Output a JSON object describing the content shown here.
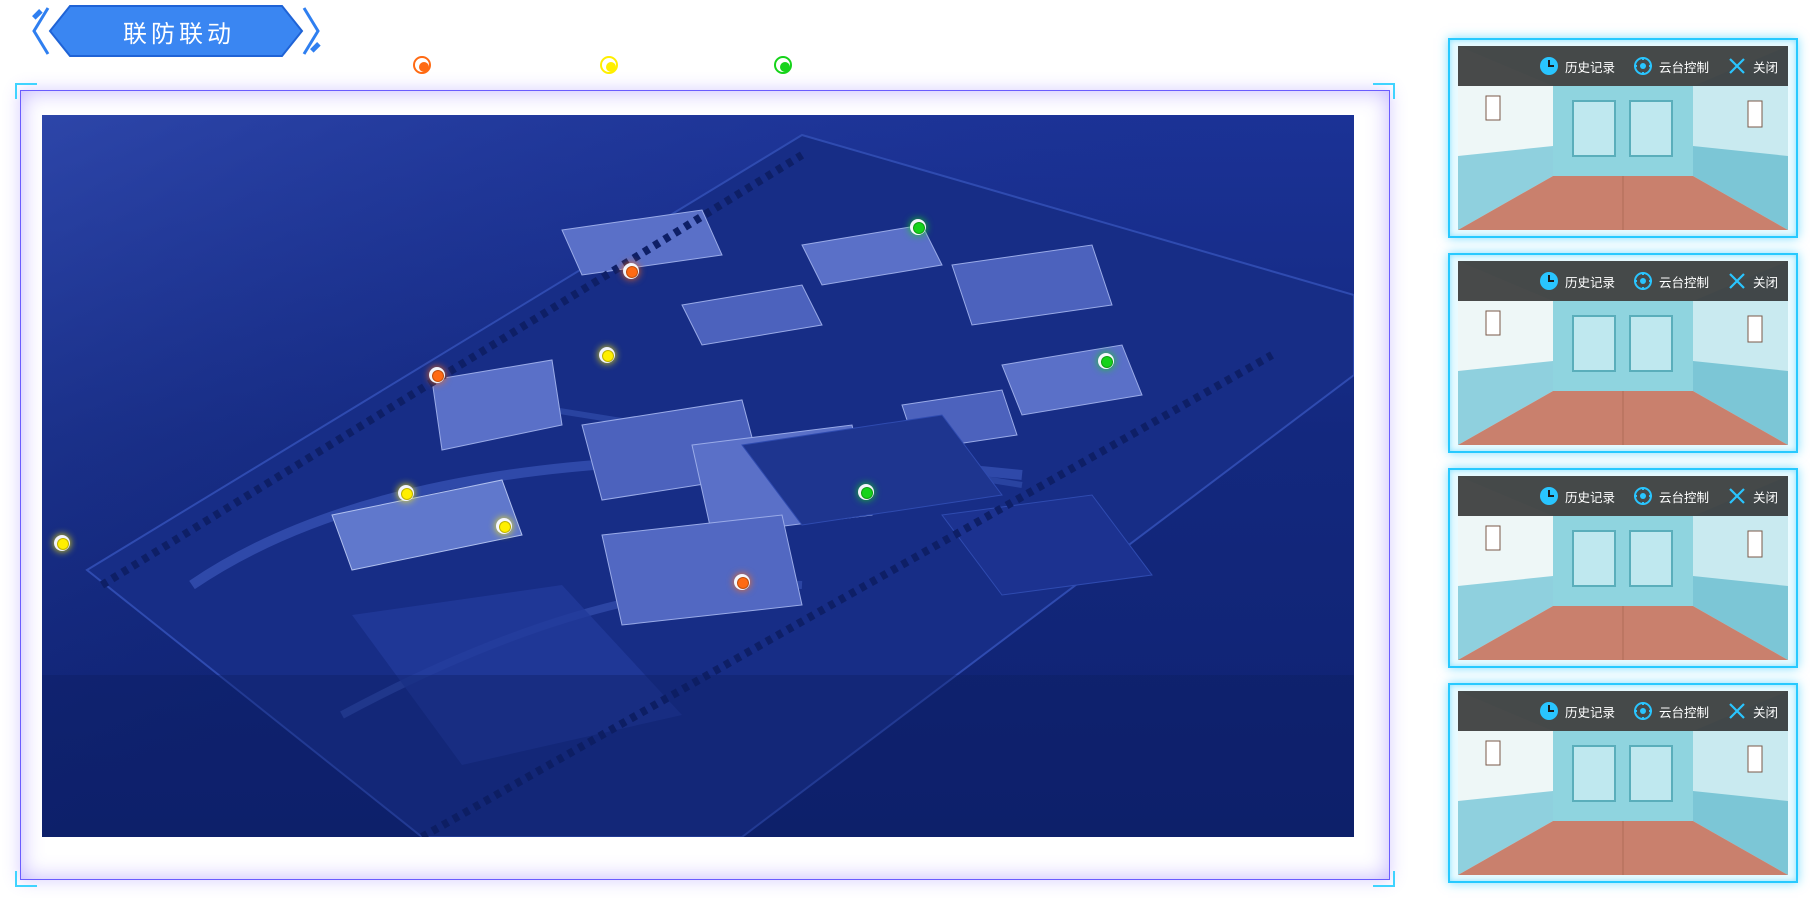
{
  "header": {
    "title": "联防联动"
  },
  "legend": [
    {
      "name": "orange",
      "color": "#ff6a13"
    },
    {
      "name": "yellow",
      "color": "#ffef00"
    },
    {
      "name": "green",
      "color": "#16d31a"
    }
  ],
  "map": {
    "markers": [
      {
        "color": "#ff6a13"
      },
      {
        "color": "#ff6a13"
      },
      {
        "color": "#ff6a13"
      },
      {
        "color": "#ffef00"
      },
      {
        "color": "#ffef00"
      },
      {
        "color": "#ffef00"
      },
      {
        "color": "#ffef00"
      },
      {
        "color": "#16d31a"
      },
      {
        "color": "#16d31a"
      },
      {
        "color": "#16d31a"
      }
    ]
  },
  "cameras": [
    {
      "history_label": "历史记录",
      "ptz_label": "云台控制",
      "close_label": "关闭"
    },
    {
      "history_label": "历史记录",
      "ptz_label": "云台控制",
      "close_label": "关闭"
    },
    {
      "history_label": "历史记录",
      "ptz_label": "云台控制",
      "close_label": "关闭"
    },
    {
      "history_label": "历史记录",
      "ptz_label": "云台控制",
      "close_label": "关闭"
    }
  ],
  "icons": {
    "history": "history-icon",
    "ptz": "ptz-control-icon",
    "close": "close-icon"
  },
  "colors": {
    "accent": "#27c9ff",
    "title_bg": "#2f7ff0",
    "frame": "#6a5cff"
  }
}
